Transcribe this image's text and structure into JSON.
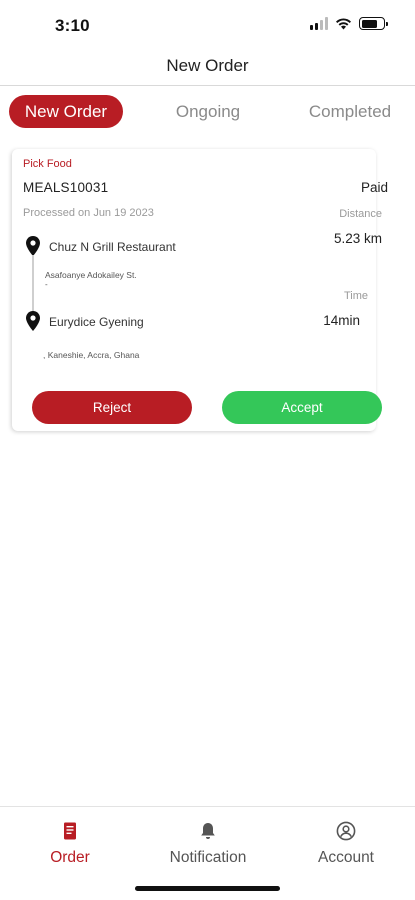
{
  "status_bar": {
    "time": "3:10"
  },
  "header": {
    "title": "New Order"
  },
  "tabs": [
    {
      "label": "New Order",
      "active": true
    },
    {
      "label": "Ongoing",
      "active": false
    },
    {
      "label": "Completed",
      "active": false
    }
  ],
  "order": {
    "category": "Pick Food",
    "order_id": "MEALS10031",
    "payment_status": "Paid",
    "processed": "Processed on  Jun 19 2023",
    "distance_label": "Distance",
    "distance": "5.23 km",
    "time_label": "Time",
    "time": "14min",
    "pickup": {
      "name": "Chuz  N  Grill Restaurant",
      "address": "Asafoanye Adokailey St.",
      "address_line2": "-"
    },
    "dropoff": {
      "name": "Eurydice Gyening",
      "address": ", Kaneshie, Accra, Ghana"
    },
    "reject_label": "Reject",
    "accept_label": "Accept"
  },
  "bottom_nav": [
    {
      "label": "Order",
      "icon": "order-icon",
      "active": true
    },
    {
      "label": "Notification",
      "icon": "bell-icon",
      "active": false
    },
    {
      "label": "Account",
      "icon": "account-icon",
      "active": false
    }
  ],
  "colors": {
    "brand": "#b81d24",
    "accept": "#34c759",
    "muted": "#8a8a8a"
  }
}
